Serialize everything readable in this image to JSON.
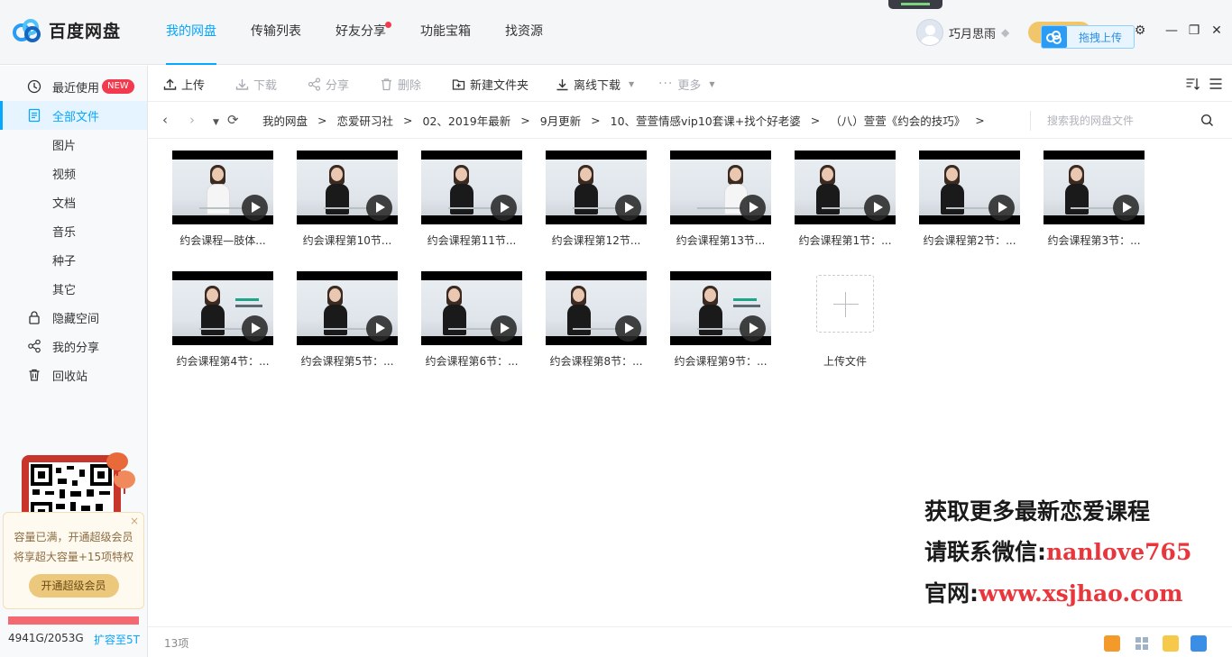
{
  "app": {
    "name": "百度网盘"
  },
  "nav": {
    "items": [
      {
        "label": "我的网盘",
        "active": true
      },
      {
        "label": "传输列表"
      },
      {
        "label": "好友分享",
        "dot": true
      },
      {
        "label": "功能宝箱"
      },
      {
        "label": "找资源"
      }
    ]
  },
  "user": {
    "name": "巧月思雨"
  },
  "upload_float": {
    "label": "拖拽上传"
  },
  "sidebar": {
    "items": [
      {
        "label": "最近使用",
        "badge": "NEW",
        "icon": "clock-icon"
      },
      {
        "label": "全部文件",
        "active": true,
        "icon": "document-icon"
      },
      {
        "label": "图片"
      },
      {
        "label": "视频"
      },
      {
        "label": "文档"
      },
      {
        "label": "音乐"
      },
      {
        "label": "种子"
      },
      {
        "label": "其它"
      },
      {
        "label": "隐藏空间",
        "icon": "lock-icon"
      },
      {
        "label": "我的分享",
        "icon": "share-icon"
      },
      {
        "label": "回收站",
        "icon": "trash-icon"
      }
    ],
    "promo": {
      "line1": "容量已满，开通超级会员",
      "line2": "将享超大容量+15项特权",
      "button": "开通超级会员",
      "close": "×"
    },
    "capacity": {
      "used_text": "4941G/2053G",
      "fill_ratio": 1.0,
      "expand_link": "扩容至5T"
    }
  },
  "toolbar": {
    "upload": "上传",
    "download": "下载",
    "share": "分享",
    "delete": "删除",
    "new_folder": "新建文件夹",
    "offline_download": "离线下载",
    "more": "更多"
  },
  "breadcrumb": {
    "items": [
      "我的网盘",
      "恋爱研习社",
      "02、2019年最新",
      "9月更新",
      "10、萱萱情感vip10套课+找个好老婆",
      "（八）萱萱《约会的技巧》"
    ],
    "separator": ">",
    "trailing": ">"
  },
  "search": {
    "placeholder": "搜索我的网盘文件"
  },
  "files": [
    {
      "name": "约会课程—肢体...",
      "variant": "white"
    },
    {
      "name": "约会课程第10节..."
    },
    {
      "name": "约会课程第11节..."
    },
    {
      "name": "约会课程第12节..."
    },
    {
      "name": "约会课程第13节...",
      "variant": "white-chair"
    },
    {
      "name": "约会课程第1节：..."
    },
    {
      "name": "约会课程第2节：..."
    },
    {
      "name": "约会课程第3节：..."
    },
    {
      "name": "约会课程第4节：...",
      "variant": "green"
    },
    {
      "name": "约会课程第5节：..."
    },
    {
      "name": "约会课程第6节：..."
    },
    {
      "name": "约会课程第8节：..."
    },
    {
      "name": "约会课程第9节：...",
      "variant": "green"
    }
  ],
  "upload_tile": {
    "label": "上传文件"
  },
  "watermark": {
    "line1": "获取更多最新恋爱课程",
    "line2_prefix": "请联系微信:",
    "line2_value": "nanlove765",
    "line3_prefix": "官网:",
    "line3_value": "www.xsjhao.com"
  },
  "status": {
    "count": "13项"
  }
}
